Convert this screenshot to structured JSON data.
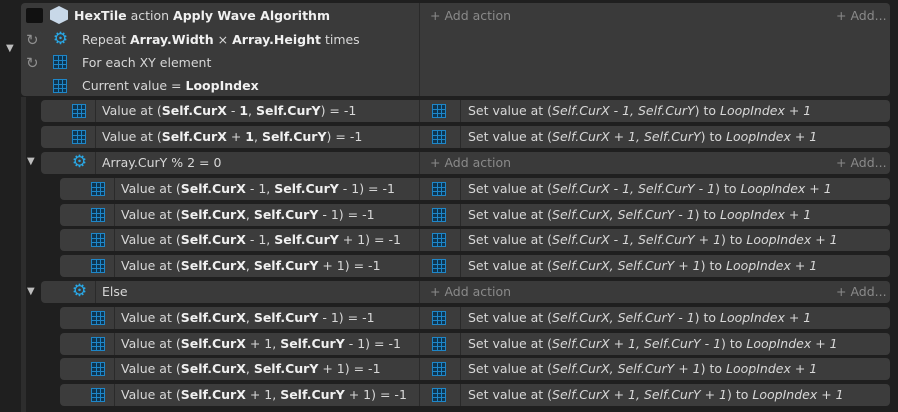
{
  "header": {
    "object": "HexTile",
    "kind": "action",
    "name": "Apply Wave Algorithm",
    "add_action": "+ Add action",
    "add_more": "+ Add..."
  },
  "loops": [
    {
      "pre": "Repeat ",
      "a": "Array.Width",
      "mid": " × ",
      "b": "Array.Height",
      "post": " times"
    },
    {
      "text": "For each XY element"
    },
    {
      "pre": "Current value = ",
      "b": "LoopIndex"
    }
  ],
  "top_rows": [
    {
      "cond": [
        "Value at (",
        "Self.CurX",
        " - ",
        "1",
        ", ",
        "Self.CurY",
        ") = -1"
      ],
      "act": [
        "Set value at (",
        "Self.CurX - 1, Self.CurY",
        ") to ",
        "LoopIndex + 1"
      ]
    },
    {
      "cond": [
        "Value at (",
        "Self.CurX",
        " + ",
        "1",
        ", ",
        "Self.CurY",
        ") = -1"
      ],
      "act": [
        "Set value at (",
        "Self.CurX + 1, Self.CurY",
        ") to ",
        "LoopIndex + 1"
      ]
    }
  ],
  "group1": {
    "cond": "Array.CurY % 2 = 0",
    "add_action": "+ Add action",
    "add_more": "+ Add...",
    "rows": [
      {
        "c1": "Self.CurX",
        "op1": " - 1, ",
        "c2": "Self.CurY",
        "op2": " - 1) = -1",
        "a1": "Self.CurX - 1, Self.CurY - 1"
      },
      {
        "c1": "Self.CurX",
        "op1": ", ",
        "c2": "Self.CurY",
        "op2": " - 1) = -1",
        "a1": "Self.CurX, Self.CurY - 1"
      },
      {
        "c1": "Self.CurX",
        "op1": " - 1, ",
        "c2": "Self.CurY",
        "op2": " + 1) = -1",
        "a1": "Self.CurX - 1, Self.CurY + 1"
      },
      {
        "c1": "Self.CurX",
        "op1": ", ",
        "c2": "Self.CurY",
        "op2": " + 1) = -1",
        "a1": "Self.CurX, Self.CurY + 1"
      }
    ]
  },
  "group2": {
    "cond": "Else",
    "add_action": "+ Add action",
    "add_more": "+ Add...",
    "rows": [
      {
        "c1": "Self.CurX",
        "op1": ", ",
        "c2": "Self.CurY",
        "op2": " - 1) = -1",
        "a1": "Self.CurX, Self.CurY - 1"
      },
      {
        "c1": "Self.CurX",
        "op1": " + 1, ",
        "c2": "Self.CurY",
        "op2": " - 1) = -1",
        "a1": "Self.CurX + 1, Self.CurY - 1"
      },
      {
        "c1": "Self.CurX",
        "op1": ", ",
        "c2": "Self.CurY",
        "op2": " + 1) = -1",
        "a1": "Self.CurX, Self.CurY + 1"
      },
      {
        "c1": "Self.CurX",
        "op1": " + 1, ",
        "c2": "Self.CurY",
        "op2": " + 1) = -1",
        "a1": "Self.CurX + 1, Self.CurY + 1"
      }
    ]
  },
  "common": {
    "value_at": "Value at (",
    "set_value_at": "Set value at (",
    "to": ") to ",
    "loop_index": "LoopIndex + 1"
  }
}
